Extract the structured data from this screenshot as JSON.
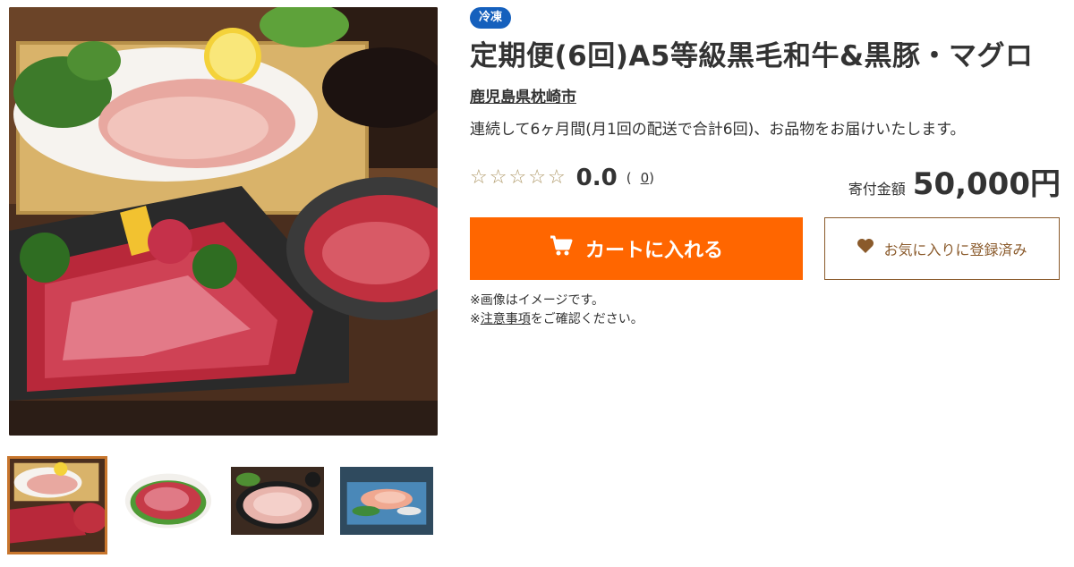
{
  "product": {
    "badge": "冷凍",
    "title": "定期便(6回)A5等級黒毛和牛&黒豚・マグロ",
    "municipality": "鹿児島県枕崎市",
    "description": "連続して6ヶ月間(月1回の配送で合計6回)、お品物をお届けいたします。",
    "rating": {
      "score": "0.0",
      "reviews": "0",
      "stars": [
        "☆",
        "☆",
        "☆",
        "☆",
        "☆"
      ],
      "open": "(",
      "close": ")"
    },
    "price_label": "寄付金額",
    "price": "50,000円"
  },
  "actions": {
    "cart_label": "カートに入れる",
    "favorite_label": "お気に入りに登録済み"
  },
  "notes": {
    "image_note": "※画像はイメージです。",
    "caution_prefix": "※",
    "caution_link": "注意事項",
    "caution_suffix": "をご確認ください。"
  },
  "icons": {
    "cart": "cart-icon",
    "heart": "heart-icon",
    "star": "star-outline-icon"
  },
  "colors": {
    "accent_orange": "#ff6600",
    "badge_blue": "#1560bd",
    "favorite_brown": "#8a5a2b",
    "thumb_active_border": "#c8762d"
  }
}
